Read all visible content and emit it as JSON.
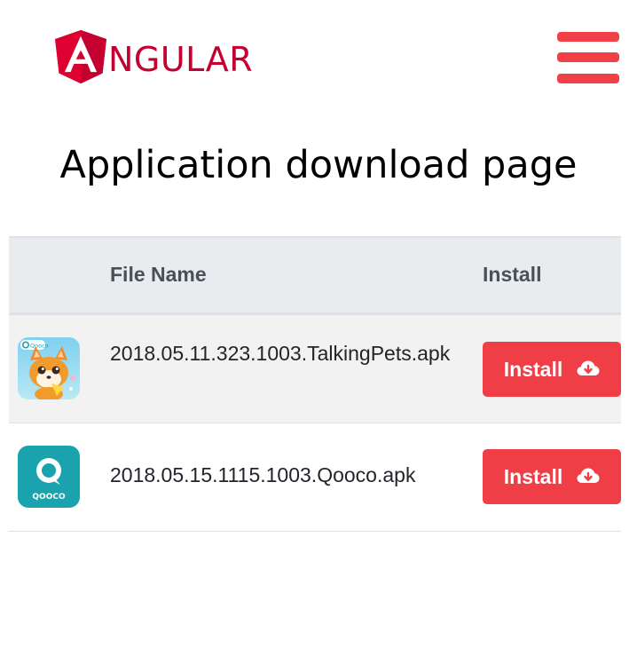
{
  "header": {
    "logo_text": "NGULAR",
    "logo_letter": "A",
    "brand_color": "#dd0031",
    "menu_color": "#f14047"
  },
  "page": {
    "title": "Application download page"
  },
  "table": {
    "columns": [
      "",
      "File Name",
      "Install"
    ],
    "rows": [
      {
        "icon": "talking-pets-app-icon",
        "file_name": "2018.05.11.323.1003.TalkingPets.apk",
        "button_label": "Install"
      },
      {
        "icon": "qooco-app-icon",
        "file_name": "2018.05.15.1115.1003.Qooco.apk",
        "button_label": "Install"
      }
    ]
  },
  "icon_labels": {
    "qooco_small": "Qooco",
    "qooco_large": "QOOCO"
  },
  "colors": {
    "install_button": "#ef3e46",
    "header_bg": "#e9ecef",
    "qooco_teal": "#1aa3ae"
  }
}
